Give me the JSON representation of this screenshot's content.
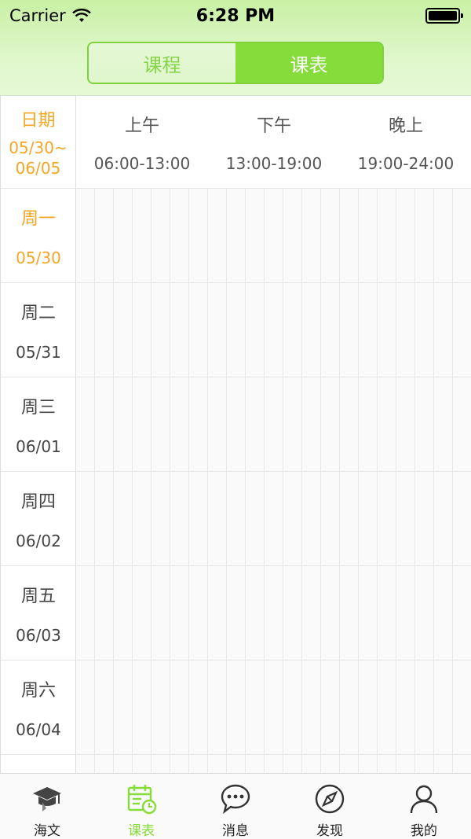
{
  "status_bar": {
    "carrier": "Carrier",
    "time": "6:28 PM"
  },
  "segmented": {
    "items": [
      {
        "label": "课程",
        "active": false
      },
      {
        "label": "课表",
        "active": true
      }
    ]
  },
  "table": {
    "date_header": {
      "label": "日期",
      "range_line1": "05/30~",
      "range_line2": "06/05"
    },
    "periods": [
      {
        "name": "上午",
        "time": "06:00-13:00"
      },
      {
        "name": "下午",
        "time": "13:00-19:00"
      },
      {
        "name": "晚上",
        "time": "19:00-24:00"
      }
    ],
    "days": [
      {
        "name": "周一",
        "date": "05/30",
        "current": true
      },
      {
        "name": "周二",
        "date": "05/31",
        "current": false
      },
      {
        "name": "周三",
        "date": "06/01",
        "current": false
      },
      {
        "name": "周四",
        "date": "06/02",
        "current": false
      },
      {
        "name": "周五",
        "date": "06/03",
        "current": false
      },
      {
        "name": "周六",
        "date": "06/04",
        "current": false
      }
    ]
  },
  "tabbar": {
    "items": [
      {
        "label": "海文",
        "icon": "graduation-cap-icon",
        "active": false
      },
      {
        "label": "课表",
        "icon": "calendar-clock-icon",
        "active": true
      },
      {
        "label": "消息",
        "icon": "chat-bubble-icon",
        "active": false
      },
      {
        "label": "发现",
        "icon": "compass-icon",
        "active": false
      },
      {
        "label": "我的",
        "icon": "person-icon",
        "active": false
      }
    ]
  },
  "colors": {
    "accent_green": "#86dc3a",
    "highlight_orange": "#f5a623"
  }
}
